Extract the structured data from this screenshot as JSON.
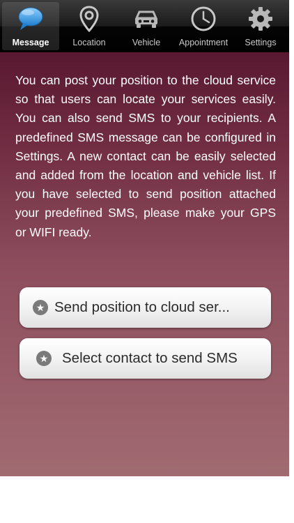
{
  "tabs": [
    {
      "label": "Message",
      "icon": "speech-bubble-icon",
      "active": true
    },
    {
      "label": "Location",
      "icon": "map-pin-icon",
      "active": false
    },
    {
      "label": "Vehicle",
      "icon": "car-icon",
      "active": false
    },
    {
      "label": "Appointment",
      "icon": "clock-icon",
      "active": false
    },
    {
      "label": "Settings",
      "icon": "gear-icon",
      "active": false
    }
  ],
  "intro": "You can post your position to the cloud service so that users can locate your services easily. You can also send SMS to your recipients. A predefined SMS message can be configured in Settings. A new contact can be easily selected and added from the location and vehicle list. If you have selected to send position attached your predefined SMS, please make your GPS or WIFI ready.",
  "buttons": {
    "cloud_label": "Send position to cloud ser...",
    "sms_label": "Select contact to send SMS"
  },
  "colors": {
    "background_top": "#4a0d26",
    "background_bottom": "#a16b72",
    "message_icon": "#3aa0e8",
    "tabbar": "#111111"
  }
}
